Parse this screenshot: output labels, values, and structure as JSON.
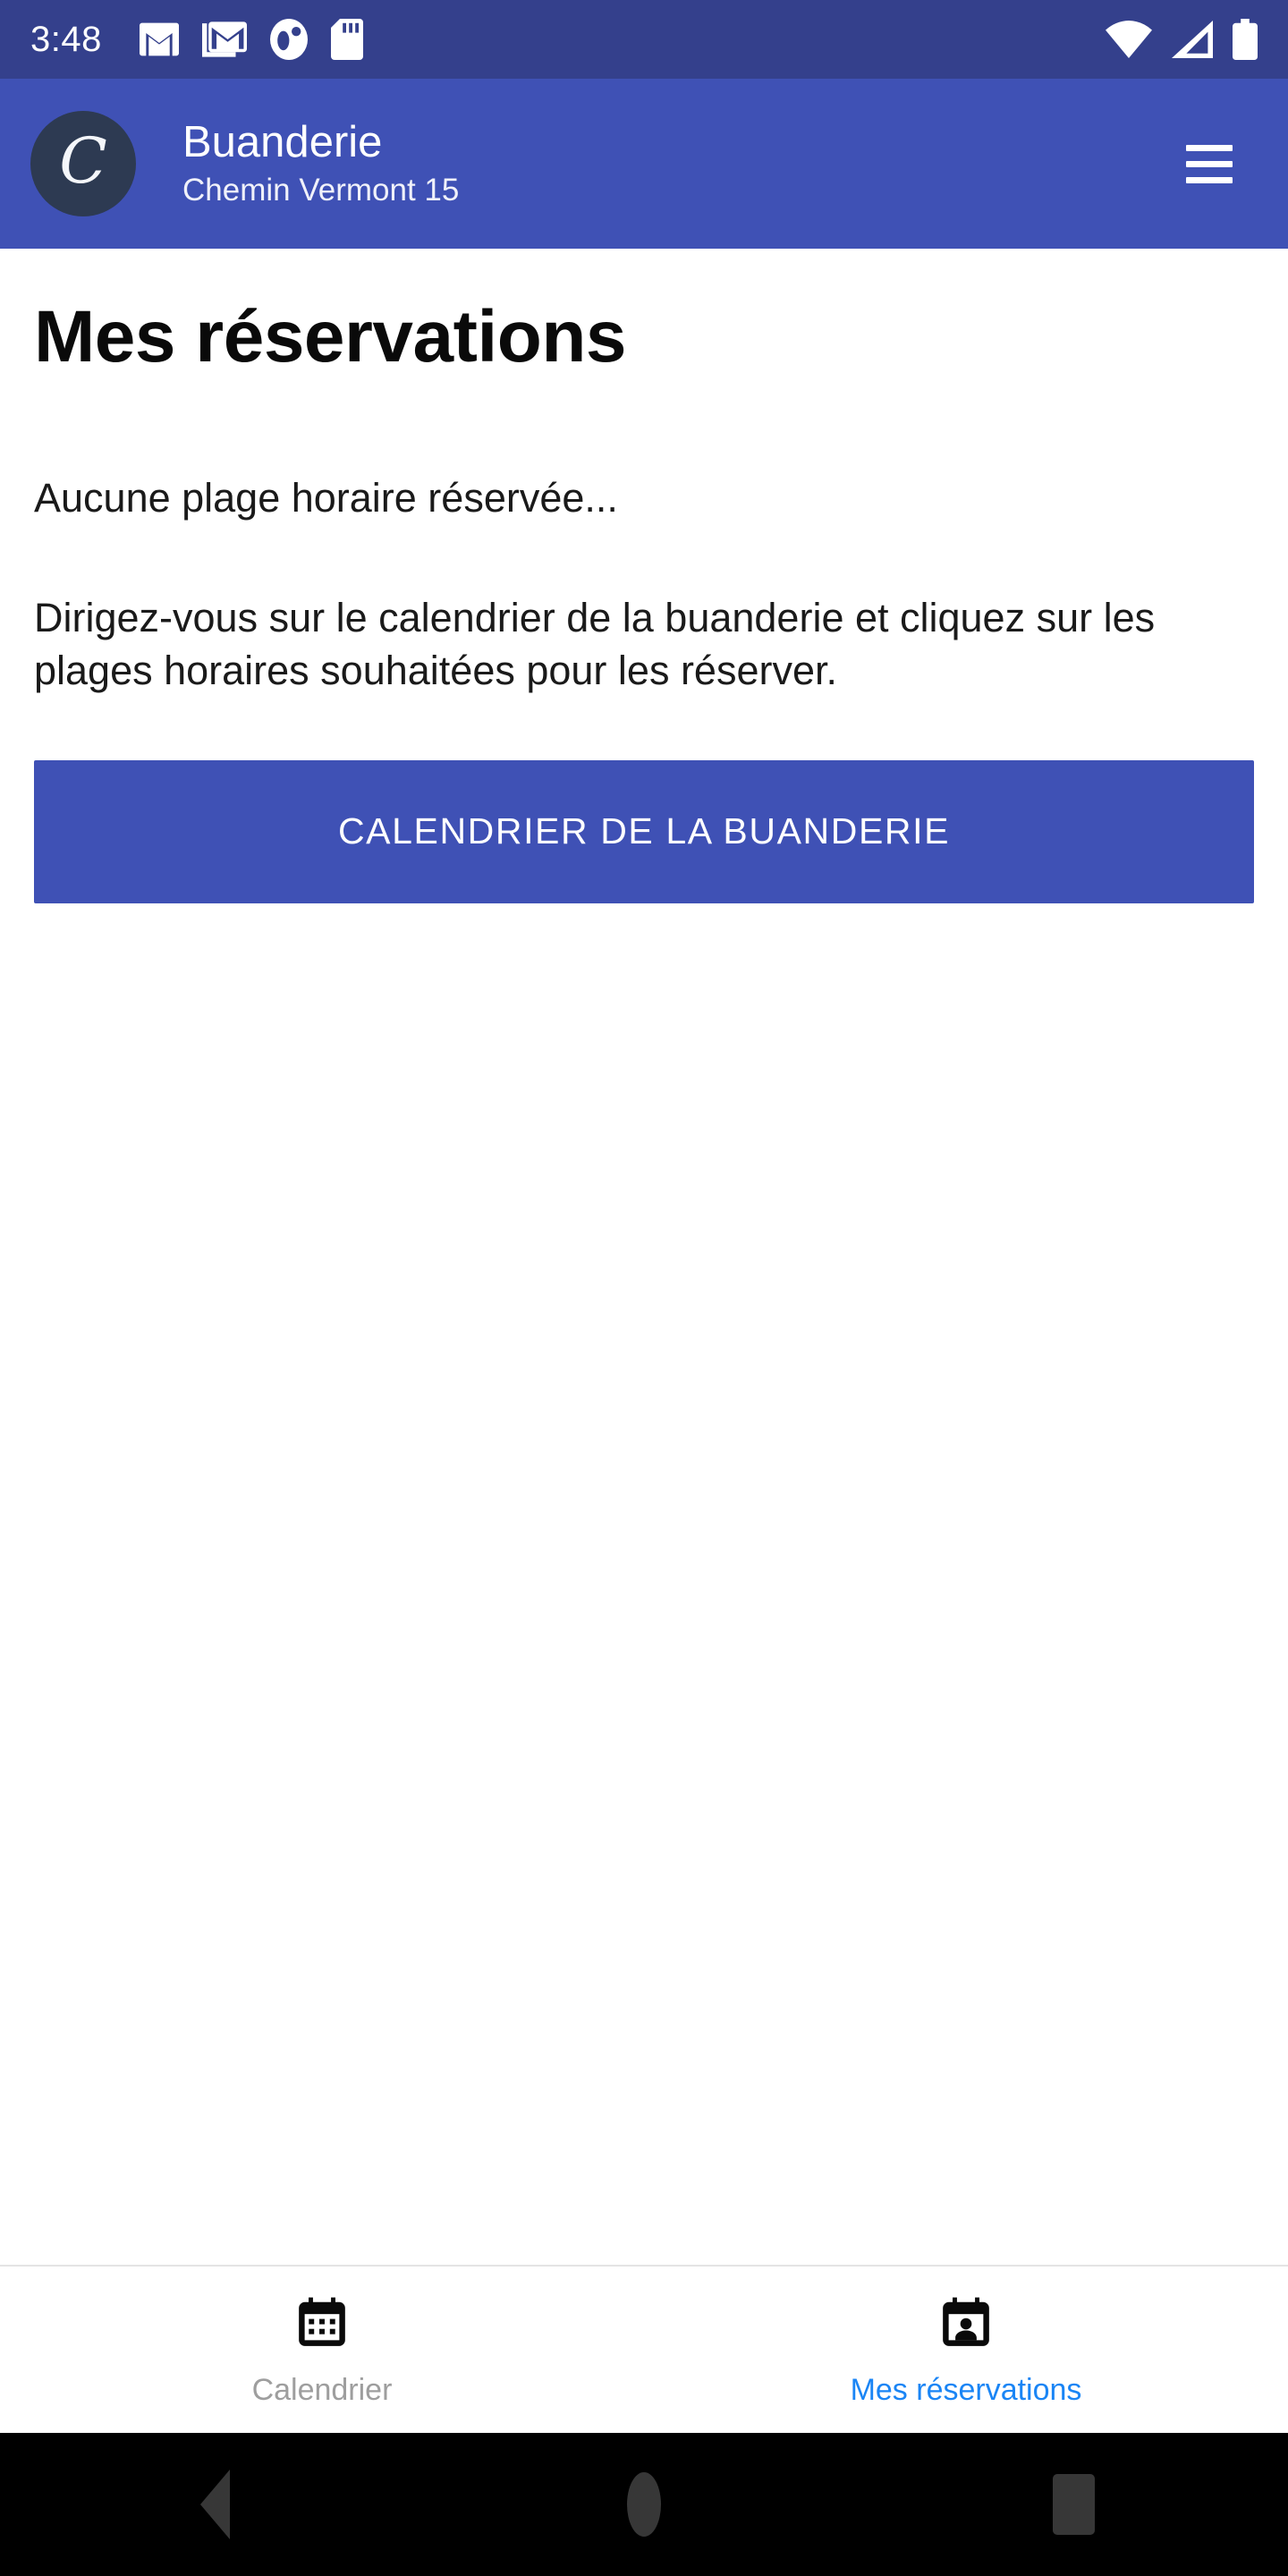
{
  "status_bar": {
    "time": "3:48",
    "left_icons": [
      "gmail-icon",
      "gmail-stack-icon",
      "circle-dot-icon",
      "sd-card-icon"
    ],
    "right_icons": [
      "wifi-icon",
      "cellular-signal-icon",
      "battery-full-icon"
    ],
    "background_color": "#34408c"
  },
  "app_bar": {
    "logo_letter": "C",
    "title": "Buanderie",
    "subtitle": "Chemin Vermont 15",
    "menu_label": "hamburger-menu",
    "background_color": "#3f51b5",
    "avatar_color": "#2d3a52"
  },
  "main": {
    "page_title": "Mes réservations",
    "empty_state": "Aucune plage horaire réservée...",
    "hint": "Dirigez-vous sur le calendrier de la buanderie et cliquez sur les plages horaires souhaitées pour les réserver.",
    "primary_button": "CALENDRIER DE LA BUANDERIE",
    "primary_button_color": "#3f51b5"
  },
  "bottom_nav": {
    "active_color": "#1a85f5",
    "inactive_color": "#9e9e9e",
    "items": [
      {
        "label": "Calendrier",
        "icon": "calendar-icon",
        "active": false
      },
      {
        "label": "Mes réservations",
        "icon": "calendar-person-icon",
        "active": true
      }
    ]
  },
  "android_nav": {
    "back_label": "back-button",
    "home_label": "home-button",
    "recents_label": "recents-button"
  }
}
